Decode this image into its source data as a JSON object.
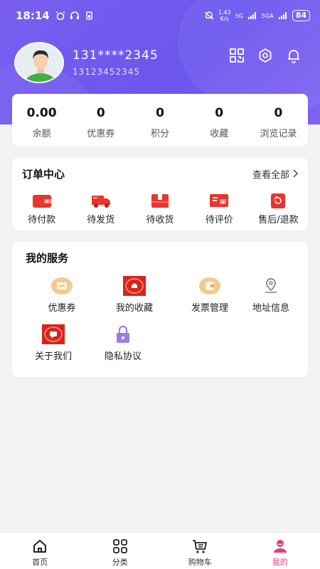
{
  "status_bar": {
    "time": "18:14",
    "speed": "1.43\nK/s",
    "net1": "5G",
    "net2": "5GA",
    "battery": "84"
  },
  "profile": {
    "name": "131****2345",
    "phone": "13123452345"
  },
  "icons": {
    "qr": "qr-code-icon",
    "settings": "gear-icon",
    "notifications": "bell-icon"
  },
  "stats": [
    {
      "value": "0.00",
      "label": "余额"
    },
    {
      "value": "0",
      "label": "优惠券"
    },
    {
      "value": "0",
      "label": "积分"
    },
    {
      "value": "0",
      "label": "收藏"
    },
    {
      "value": "0",
      "label": "浏览记录"
    }
  ],
  "orders": {
    "title": "订单中心",
    "more": "查看全部",
    "items": [
      {
        "label": "待付款",
        "icon": "wallet-icon"
      },
      {
        "label": "待发货",
        "icon": "truck-icon"
      },
      {
        "label": "待收货",
        "icon": "box-icon"
      },
      {
        "label": "待评价",
        "icon": "review-icon"
      },
      {
        "label": "售后/退款",
        "icon": "refund-icon"
      }
    ]
  },
  "services": {
    "title": "我的服务",
    "items": [
      {
        "label": "优惠券",
        "icon": "coupon-icon"
      },
      {
        "label": "我的收藏",
        "icon": "favorites-icon"
      },
      {
        "label": "发票管理",
        "icon": "invoice-icon"
      },
      {
        "label": "地址信息",
        "icon": "location-icon"
      },
      {
        "label": "关于我们",
        "icon": "about-icon"
      },
      {
        "label": "隐私协议",
        "icon": "lock-icon"
      }
    ]
  },
  "tabbar": {
    "items": [
      {
        "label": "首页",
        "icon": "home-icon"
      },
      {
        "label": "分类",
        "icon": "grid-icon"
      },
      {
        "label": "购物车",
        "icon": "cart-icon"
      },
      {
        "label": "我的",
        "icon": "profile-icon",
        "active": true
      }
    ]
  },
  "colors": {
    "header": "#6b56ee",
    "accent_red": "#e8352d",
    "active_tab": "#e23c78"
  }
}
